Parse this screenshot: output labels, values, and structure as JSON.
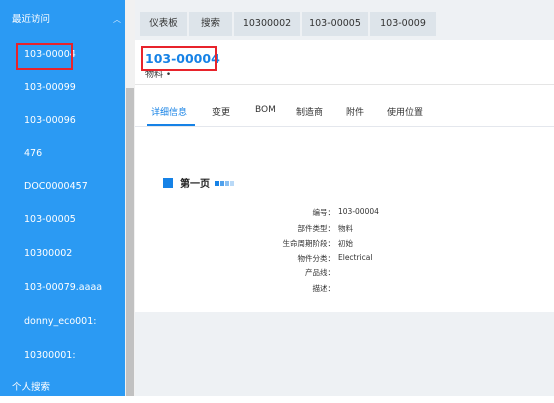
{
  "sidebar": {
    "section_recent": "最近访问",
    "items": [
      "103-00004",
      "103-00099",
      "103-00096",
      "476",
      "DOC0000457",
      "103-00005",
      "10300002",
      "103-00079.aaaa",
      "donny_eco001:",
      "10300001:"
    ],
    "section_personal": "个人搜索"
  },
  "tabs": [
    "仪表板",
    "搜索",
    "10300002",
    "103-00005",
    "103-0009"
  ],
  "page": {
    "title": "103-00004",
    "subtitle": "物料 •"
  },
  "detail_tabs": [
    "详细信息",
    "变更",
    "BOM",
    "制造商",
    "附件",
    "使用位置"
  ],
  "section": {
    "title": "第一页"
  },
  "fields": [
    {
      "label": "编号",
      "value": "103-00004"
    },
    {
      "label": "部件类型",
      "value": "物料"
    },
    {
      "label": "生命周期阶段",
      "value": "初始"
    },
    {
      "label": "物件分类",
      "value": "Electrical"
    },
    {
      "label": "产品线",
      "value": ""
    },
    {
      "label": "描述",
      "value": ""
    }
  ],
  "colors": {
    "sidebar_bg": "#2b9af3",
    "accent": "#1682e6",
    "highlight": "#e8232b"
  }
}
